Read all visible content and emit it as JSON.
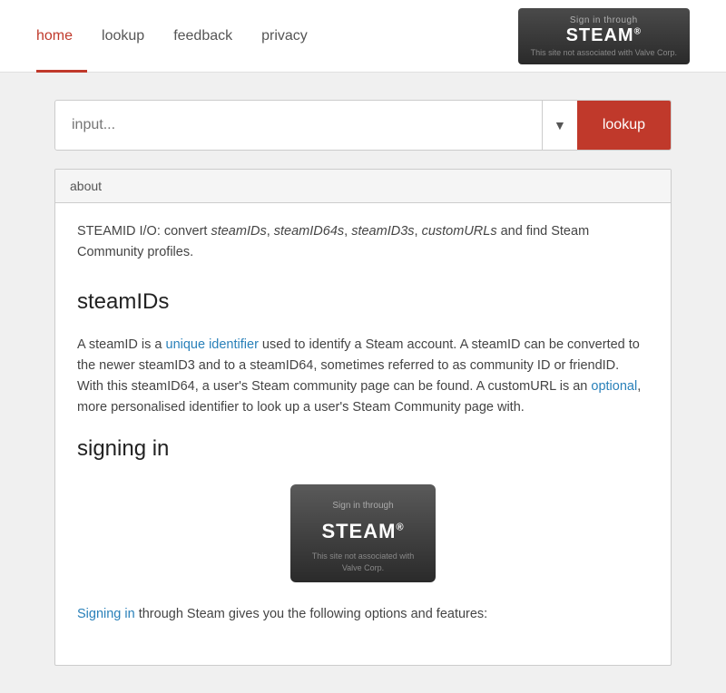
{
  "nav": {
    "items": [
      {
        "label": "home",
        "active": true
      },
      {
        "label": "lookup",
        "active": false
      },
      {
        "label": "feedback",
        "active": false
      },
      {
        "label": "privacy",
        "active": false
      }
    ]
  },
  "header_steam_btn": {
    "sign_in": "Sign in through",
    "logo": "STEAM",
    "trademark": "®",
    "not_associated": "This site not associated with Valve Corp."
  },
  "search": {
    "placeholder": "input...",
    "lookup_label": "lookup",
    "dropdown_symbol": "▼"
  },
  "about": {
    "section_label": "about",
    "intro": "STEAMID I/O: convert steamIDs, steamID64s, steamID3s, customURLs and find Steam Community profiles.",
    "section1_heading": "steamIDs",
    "section1_body": "A steamID is a unique identifier used to identify a Steam account. A steamID can be converted to the newer steamID3 and to a steamID64, sometimes referred to as community ID or friendID. With this steamID64, a user's Steam community page can be found. A customURL is an optional, more personalised identifier to look up a user's Steam Community page with.",
    "section2_heading": "signing in",
    "steam_btn_sign_in": "Sign in through",
    "steam_btn_logo": "STEAM",
    "steam_btn_trademark": "®",
    "steam_btn_not_associated": "This site not associated with Valve Corp.",
    "section2_intro": "Signing in through Steam gives you the following options and features:"
  }
}
